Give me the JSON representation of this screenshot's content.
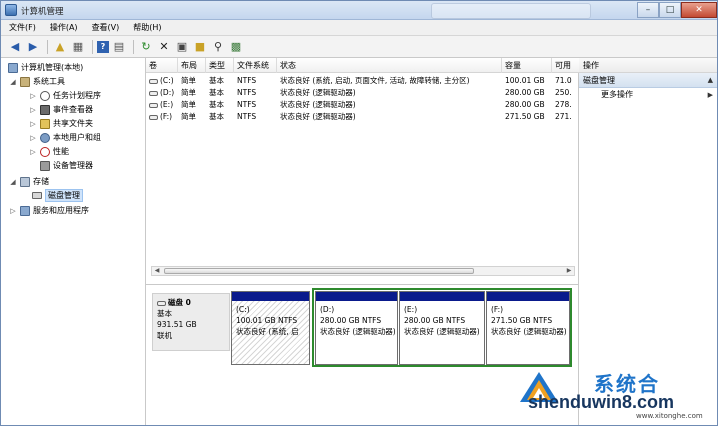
{
  "window": {
    "title": "计算机管理"
  },
  "menubar": [
    "文件(F)",
    "操作(A)",
    "查看(V)",
    "帮助(H)"
  ],
  "toolbar": {
    "icons": [
      "back-arrow-icon",
      "forward-arrow-icon",
      "up-folder-icon",
      "console-tree-icon",
      "help-icon",
      "properties-icon",
      "refresh-icon",
      "delete-icon",
      "open-icon",
      "folder-icon",
      "search-icon",
      "disk-icon"
    ]
  },
  "tree": {
    "root": "计算机管理(本地)",
    "system_tools": "系统工具",
    "task_scheduler": "任务计划程序",
    "event_viewer": "事件查看器",
    "shared_folders": "共享文件夹",
    "local_users": "本地用户和组",
    "performance": "性能",
    "device_manager": "设备管理器",
    "storage": "存储",
    "disk_management": "磁盘管理",
    "services_apps": "服务和应用程序"
  },
  "volumes": {
    "columns": [
      "卷",
      "布局",
      "类型",
      "文件系统",
      "状态",
      "容量",
      "可用"
    ],
    "rows": [
      {
        "vol": "(C:)",
        "layout": "简单",
        "type": "基本",
        "fs": "NTFS",
        "status": "状态良好 (系统, 启动, 页面文件, 活动, 故障转储, 主分区)",
        "capacity": "100.01 GB",
        "free": "71.0"
      },
      {
        "vol": "(D:)",
        "layout": "简单",
        "type": "基本",
        "fs": "NTFS",
        "status": "状态良好 (逻辑驱动器)",
        "capacity": "280.00 GB",
        "free": "250."
      },
      {
        "vol": "(E:)",
        "layout": "简单",
        "type": "基本",
        "fs": "NTFS",
        "status": "状态良好 (逻辑驱动器)",
        "capacity": "280.00 GB",
        "free": "278."
      },
      {
        "vol": "(F:)",
        "layout": "简单",
        "type": "基本",
        "fs": "NTFS",
        "status": "状态良好 (逻辑驱动器)",
        "capacity": "271.50 GB",
        "free": "271."
      }
    ]
  },
  "disk": {
    "name": "磁盘 0",
    "type": "基本",
    "size": "931.51 GB",
    "status": "联机",
    "partitions": [
      {
        "label": "(C:)",
        "size": "100.01 GB NTFS",
        "status": "状态良好 (系统, 启"
      },
      {
        "label": "(D:)",
        "size": "280.00 GB NTFS",
        "status": "状态良好 (逻辑驱动器)"
      },
      {
        "label": "(E:)",
        "size": "280.00 GB NTFS",
        "status": "状态良好 (逻辑驱动器)"
      },
      {
        "label": "(F:)",
        "size": "271.50 GB NTFS",
        "status": "状态良好 (逻辑驱动器)"
      }
    ]
  },
  "actions": {
    "header": "操作",
    "section": "磁盘管理",
    "more": "更多操作"
  },
  "watermark": {
    "cn": "系统合",
    "url": "shenduwin8.com",
    "small": "www.xitonghe.com"
  },
  "colors": {
    "partition_bar": "#0a1a8c",
    "extended_frame": "#2d8a2d",
    "selection": "#cfe3fa"
  }
}
